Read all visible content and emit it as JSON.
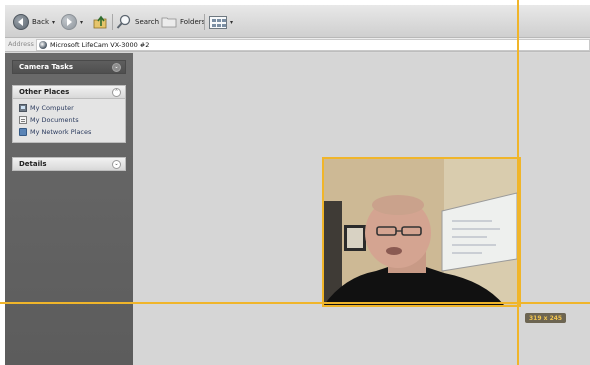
{
  "toolbar": {
    "back_label": "Back",
    "search_label": "Search",
    "folders_label": "Folders"
  },
  "address": {
    "label": "Address",
    "value": "Microsoft LifeCam VX-3000 #2"
  },
  "sidebar": {
    "camera_tasks": {
      "title": "Camera Tasks",
      "state_icon": "chevron-double-down-icon"
    },
    "other_places": {
      "title": "Other Places",
      "state_icon": "chevron-double-up-icon",
      "items": [
        {
          "label": "My Computer",
          "icon": "computer-icon"
        },
        {
          "label": "My Documents",
          "icon": "documents-icon"
        },
        {
          "label": "My Network Places",
          "icon": "network-places-icon"
        }
      ]
    },
    "details": {
      "title": "Details",
      "state_icon": "chevron-double-down-icon"
    }
  },
  "viewer": {
    "frame_size_label": "319 x 245"
  },
  "colors": {
    "guide": "#f0b52a",
    "sidebar": "#666666",
    "canvas": "#d6d6d6"
  }
}
